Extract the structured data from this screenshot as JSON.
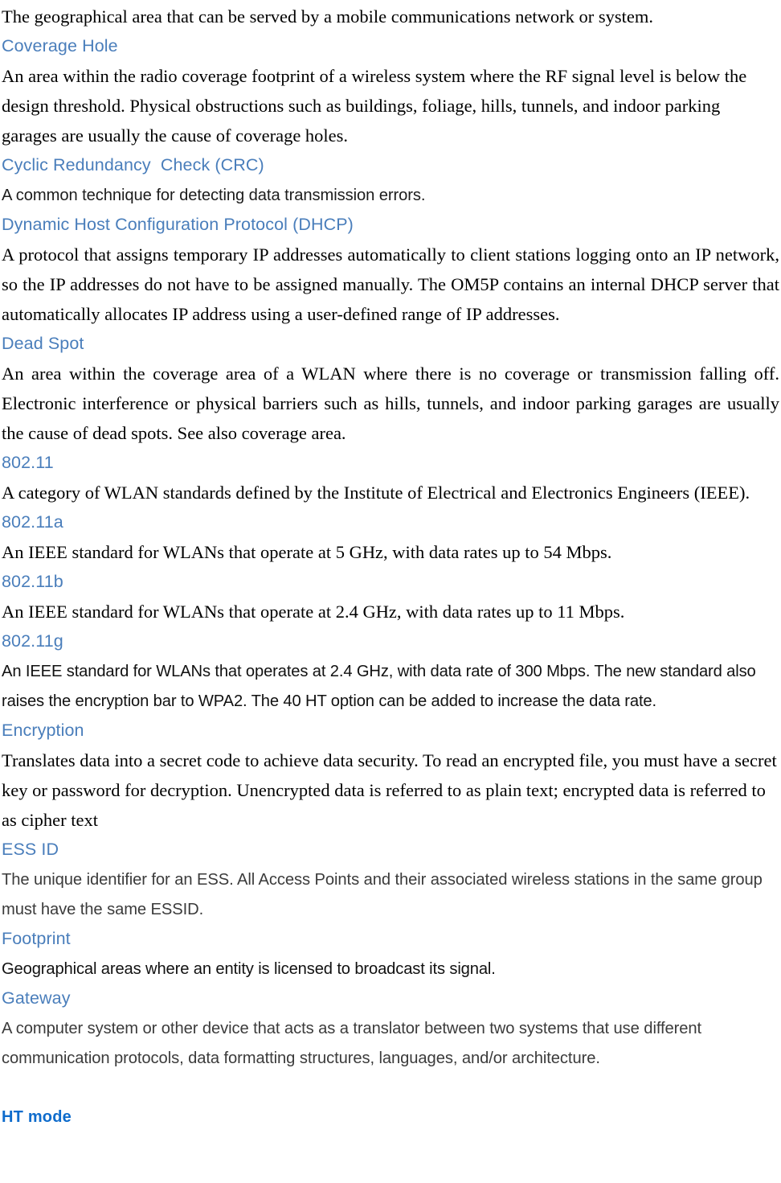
{
  "page": {
    "kind": "glossary-continuation",
    "accent_color": "#4a7ebb",
    "accent_bold_color": "#0f6ccc",
    "body_color": "#000000",
    "body_gray_color": "#3b3b3b",
    "background": "#ffffff"
  },
  "intro": {
    "text": "The geographical area that can be served by a mobile communications network or system."
  },
  "entries": [
    {
      "term": "Coverage Hole",
      "definition": "An area within the radio coverage footprint of a wireless system where the RF signal level is below the design threshold. Physical obstructions such as buildings, foliage, hills, tunnels, and indoor parking garages are usually the cause of coverage holes."
    },
    {
      "term": "Cyclic Redundancy  Check (CRC)",
      "definition": "A common  technique for detecting data transmission errors."
    },
    {
      "term": "Dynamic Host Configuration Protocol (DHCP)",
      "definition": "A protocol that assigns temporary IP addresses automatically to client stations logging onto an IP network, so the IP addresses do not have to be assigned manually. The OM5P contains an internal DHCP server that automatically allocates IP address using a user-defined range of IP addresses."
    },
    {
      "term": "Dead Spot",
      "definition": "An area within the coverage area of a WLAN where there is no coverage or transmission falling off. Electronic interference or physical barriers such as hills, tunnels, and indoor parking garages are usually the cause of dead spots. See also coverage area."
    },
    {
      "term": "802.11",
      "definition": "A category of WLAN standards defined by the Institute of Electrical and Electronics Engineers (IEEE)."
    },
    {
      "term": "802.11a",
      "definition": "An IEEE standard for WLANs that operate at 5 GHz, with data rates up to 54 Mbps."
    },
    {
      "term": "802.11b",
      "definition": "An IEEE standard for WLANs that operate at 2.4 GHz, with data rates up to 11 Mbps."
    },
    {
      "term": "802.11g",
      "definition": "An  IEEE standard for WLANs that operates at 2.4 GHz, with data rate of 300 Mbps.  The new standard also raises the encryption bar to WPA2. The 40 HT option can be added to increase the data rate."
    },
    {
      "term": "Encryption",
      "definition": "Translates data into a secret code to achieve data security. To read an encrypted file, you must have a secret key or password for decryption. Unencrypted data is referred to as plain text; encrypted data is referred to as cipher text"
    },
    {
      "term": "ESS ID",
      "definition": "The unique identifier for an ESS. All  Access Points and their associated wireless stations in the same group  must have the same ESSID."
    },
    {
      "term": "Footprint",
      "definition": "Geographical areas where  an entity is licensed to broadcast its signal."
    },
    {
      "term": "Gateway",
      "definition": "A computer system or other device that acts as a translator between two systems that use different communication protocols, data formatting structures, languages, and/or architecture."
    },
    {
      "term": "HT mode",
      "definition": ""
    }
  ]
}
